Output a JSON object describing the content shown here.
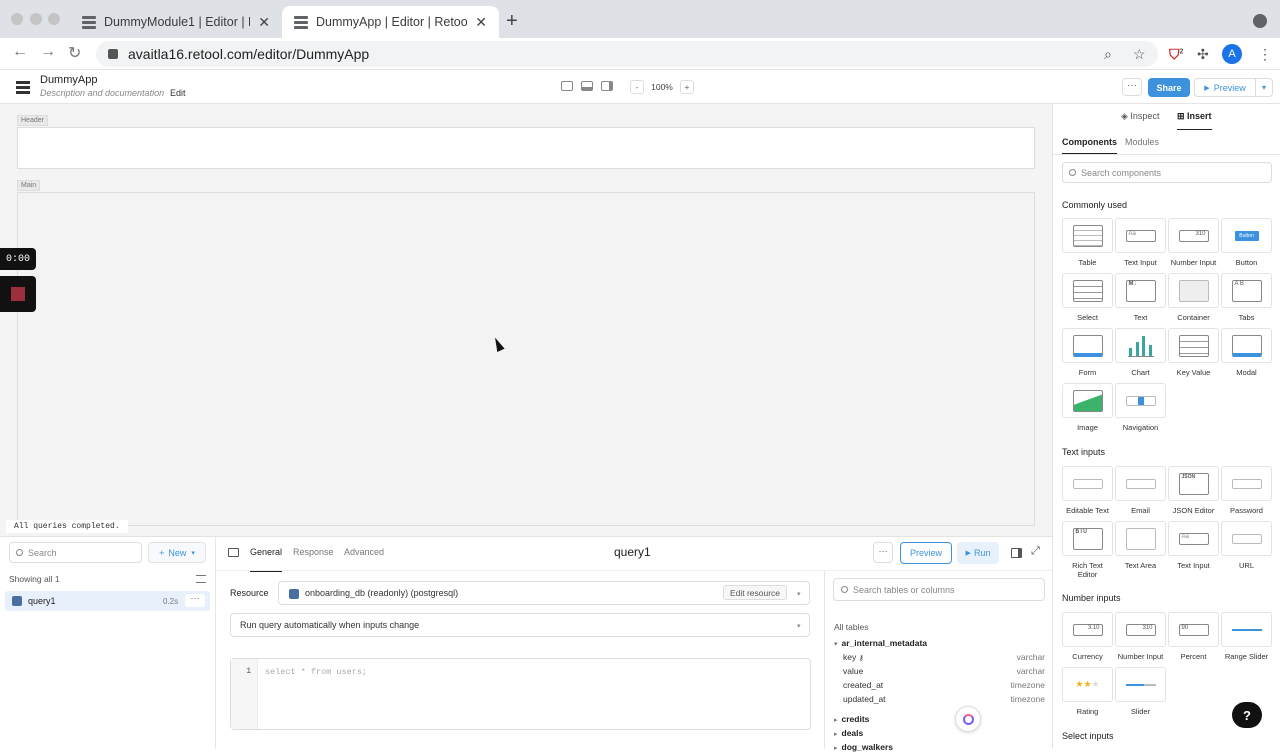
{
  "browser": {
    "tabs": [
      {
        "label": "DummyModule1 | Editor | Retool",
        "active": false
      },
      {
        "label": "DummyApp | Editor | Retool",
        "active": true
      }
    ],
    "url": "avaitla16.retool.com/editor/DummyApp",
    "avatar_letter": "A",
    "extension_badge": "2"
  },
  "appbar": {
    "app_name": "DummyApp",
    "description": "Description and documentation",
    "edit_label": "Edit",
    "zoom_minus": "-",
    "zoom": "100%",
    "zoom_plus": "+",
    "more_label": "···",
    "share_label": "Share",
    "preview_label": "Preview",
    "preview_icon": "play-icon",
    "dropdown_icon": "chevron-down-icon"
  },
  "canvas": {
    "header_tag": "Header",
    "main_tag": "Main",
    "status_message": "All queries completed.",
    "recording_time": "0:00"
  },
  "right_panel": {
    "tabs": {
      "inspect": "Inspect",
      "insert": "Insert"
    },
    "subtabs": {
      "components": "Components",
      "modules": "Modules"
    },
    "search_placeholder": "Search components",
    "groups": {
      "commonly_used": {
        "title": "Commonly used",
        "items": [
          "Table",
          "Text Input",
          "Number Input",
          "Button",
          "Select",
          "Text",
          "Container",
          "Tabs",
          "Form",
          "Chart",
          "Key Value",
          "Modal",
          "Image",
          "Navigation"
        ]
      },
      "text_inputs": {
        "title": "Text inputs",
        "items": [
          "Editable Text",
          "Email",
          "JSON Editor",
          "Password",
          "Rich Text Editor",
          "Text Area",
          "Text Input",
          "URL"
        ]
      },
      "number_inputs": {
        "title": "Number inputs",
        "items": [
          "Currency",
          "Number Input",
          "Percent",
          "Range Slider",
          "Rating",
          "Slider"
        ]
      },
      "select_inputs": {
        "title": "Select inputs"
      }
    },
    "glyph_text": {
      "number": "310",
      "button": "Button",
      "json": "JSON",
      "percent": "90",
      "aa": "Aa",
      "md": "M↓",
      "currency": "3.10"
    }
  },
  "query_panel": {
    "search_placeholder": "Search",
    "new_label": "New",
    "showing": "Showing all 1",
    "query": {
      "name": "query1",
      "time": "0.2s",
      "more": "···"
    },
    "editor_tabs": {
      "general": "General",
      "response": "Response",
      "advanced": "Advanced"
    },
    "title": "query1",
    "more_label": "···",
    "preview_label": "Preview",
    "run_label": "Run",
    "resource_label": "Resource",
    "resource_value": "onboarding_db (readonly) (postgresql)",
    "edit_resource": "Edit resource",
    "run_mode": "Run query automatically when inputs change",
    "line_number": "1",
    "sql": "select * from users;"
  },
  "schema": {
    "search_placeholder": "Search tables or columns",
    "all_tables_label": "All tables",
    "tables": [
      {
        "name": "ar_internal_metadata",
        "expanded": true,
        "columns": [
          {
            "name": "key",
            "type": "varchar",
            "key": true
          },
          {
            "name": "value",
            "type": "varchar"
          },
          {
            "name": "created_at",
            "type": "timezone"
          },
          {
            "name": "updated_at",
            "type": "timezone"
          }
        ]
      },
      {
        "name": "credits",
        "expanded": false
      },
      {
        "name": "deals",
        "expanded": false
      },
      {
        "name": "dog_walkers",
        "expanded": false
      }
    ]
  },
  "help_label": "?"
}
